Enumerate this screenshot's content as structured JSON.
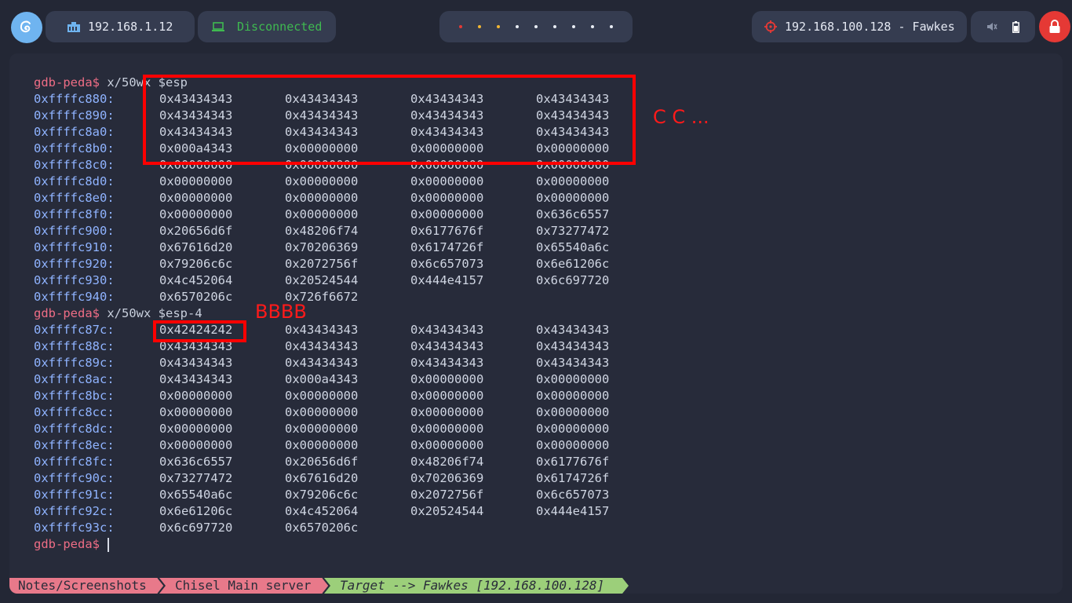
{
  "topbar": {
    "ip_local": "192.168.1.12",
    "vpn_status": "Disconnected",
    "target": "192.168.100.128 - Fawkes",
    "colors": {
      "pill_bg": "#353c50",
      "vpn_green": "#3fb950",
      "target_red": "#e53935",
      "logo_blue": "#6fb4f0"
    },
    "icons": [
      "debian-logo-icon",
      "network-icon",
      "laptop-icon",
      "target-icon",
      "mute-icon",
      "battery-icon",
      "lock-icon"
    ]
  },
  "terminal": {
    "cmd1": {
      "prompt": "gdb-peda$",
      "command": " x/50wx $esp"
    },
    "dump1": [
      {
        "addr": "0xffffc880:",
        "w": [
          "0x43434343",
          "0x43434343",
          "0x43434343",
          "0x43434343"
        ]
      },
      {
        "addr": "0xffffc890:",
        "w": [
          "0x43434343",
          "0x43434343",
          "0x43434343",
          "0x43434343"
        ]
      },
      {
        "addr": "0xffffc8a0:",
        "w": [
          "0x43434343",
          "0x43434343",
          "0x43434343",
          "0x43434343"
        ]
      },
      {
        "addr": "0xffffc8b0:",
        "w": [
          "0x000a4343",
          "0x00000000",
          "0x00000000",
          "0x00000000"
        ]
      },
      {
        "addr": "0xffffc8c0:",
        "w": [
          "0x00000000",
          "0x00000000",
          "0x00000000",
          "0x00000000"
        ]
      },
      {
        "addr": "0xffffc8d0:",
        "w": [
          "0x00000000",
          "0x00000000",
          "0x00000000",
          "0x00000000"
        ]
      },
      {
        "addr": "0xffffc8e0:",
        "w": [
          "0x00000000",
          "0x00000000",
          "0x00000000",
          "0x00000000"
        ]
      },
      {
        "addr": "0xffffc8f0:",
        "w": [
          "0x00000000",
          "0x00000000",
          "0x00000000",
          "0x636c6557"
        ]
      },
      {
        "addr": "0xffffc900:",
        "w": [
          "0x20656d6f",
          "0x48206f74",
          "0x6177676f",
          "0x73277472"
        ]
      },
      {
        "addr": "0xffffc910:",
        "w": [
          "0x67616d20",
          "0x70206369",
          "0x6174726f",
          "0x65540a6c"
        ]
      },
      {
        "addr": "0xffffc920:",
        "w": [
          "0x79206c6c",
          "0x2072756f",
          "0x6c657073",
          "0x6e61206c"
        ]
      },
      {
        "addr": "0xffffc930:",
        "w": [
          "0x4c452064",
          "0x20524544",
          "0x444e4157",
          "0x6c697720"
        ]
      },
      {
        "addr": "0xffffc940:",
        "w": [
          "0x6570206c",
          "0x726f6672",
          "",
          ""
        ]
      }
    ],
    "cmd2": {
      "prompt": "gdb-peda$",
      "command": " x/50wx $esp-4"
    },
    "dump2": [
      {
        "addr": "0xffffc87c:",
        "w": [
          "0x42424242",
          "0x43434343",
          "0x43434343",
          "0x43434343"
        ]
      },
      {
        "addr": "0xffffc88c:",
        "w": [
          "0x43434343",
          "0x43434343",
          "0x43434343",
          "0x43434343"
        ]
      },
      {
        "addr": "0xffffc89c:",
        "w": [
          "0x43434343",
          "0x43434343",
          "0x43434343",
          "0x43434343"
        ]
      },
      {
        "addr": "0xffffc8ac:",
        "w": [
          "0x43434343",
          "0x000a4343",
          "0x00000000",
          "0x00000000"
        ]
      },
      {
        "addr": "0xffffc8bc:",
        "w": [
          "0x00000000",
          "0x00000000",
          "0x00000000",
          "0x00000000"
        ]
      },
      {
        "addr": "0xffffc8cc:",
        "w": [
          "0x00000000",
          "0x00000000",
          "0x00000000",
          "0x00000000"
        ]
      },
      {
        "addr": "0xffffc8dc:",
        "w": [
          "0x00000000",
          "0x00000000",
          "0x00000000",
          "0x00000000"
        ]
      },
      {
        "addr": "0xffffc8ec:",
        "w": [
          "0x00000000",
          "0x00000000",
          "0x00000000",
          "0x00000000"
        ]
      },
      {
        "addr": "0xffffc8fc:",
        "w": [
          "0x636c6557",
          "0x20656d6f",
          "0x48206f74",
          "0x6177676f"
        ]
      },
      {
        "addr": "0xffffc90c:",
        "w": [
          "0x73277472",
          "0x67616d20",
          "0x70206369",
          "0x6174726f"
        ]
      },
      {
        "addr": "0xffffc91c:",
        "w": [
          "0x65540a6c",
          "0x79206c6c",
          "0x2072756f",
          "0x6c657073"
        ]
      },
      {
        "addr": "0xffffc92c:",
        "w": [
          "0x6e61206c",
          "0x4c452064",
          "0x20524544",
          "0x444e4157"
        ]
      },
      {
        "addr": "0xffffc93c:",
        "w": [
          "0x6c697720",
          "0x6570206c",
          "",
          ""
        ]
      }
    ],
    "final_prompt": "gdb-peda$"
  },
  "annotations": {
    "label_c": "C C ...",
    "label_b": "BBBB",
    "color": "#ff0000"
  },
  "statusbar": {
    "seg1": "Notes/Screenshots",
    "seg2": "Chisel Main server",
    "seg3": "Target --> Fawkes [192.168.100.128]",
    "colors": {
      "seg1": "#e8798a",
      "seg2": "#e8798a",
      "seg3": "#9ccf7a"
    }
  }
}
